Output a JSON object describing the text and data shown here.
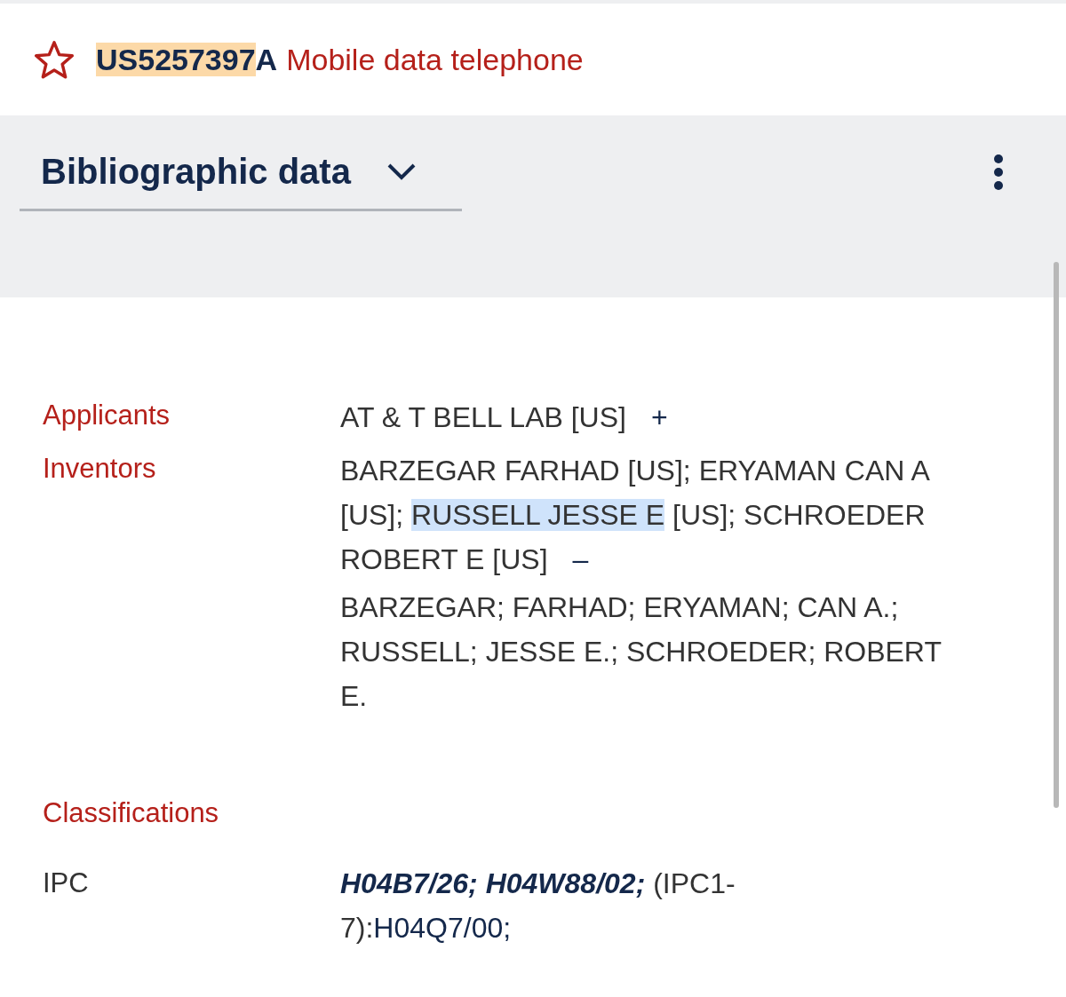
{
  "header": {
    "starred": false,
    "number": [
      {
        "text": "US5257397",
        "highlighted": true
      },
      {
        "text": "A",
        "highlighted": false
      }
    ],
    "title": "Mobile data telephone"
  },
  "section_tab": {
    "label": "Bibliographic data",
    "expanded": false
  },
  "fields": [
    {
      "label": "Applicants",
      "toggle": "+",
      "lines": [
        [
          {
            "text": "AT & T BELL LAB [US]",
            "selected": false
          }
        ]
      ]
    },
    {
      "label": "Inventors",
      "toggle": "–",
      "lines": [
        [
          {
            "text": "BARZEGAR FARHAD [US]; ERYAMAN CAN A [US]; ",
            "selected": false
          },
          {
            "text": "RUSSELL JESSE E",
            "selected": true
          },
          {
            "text": " [US]; SCHROEDER ROBERT E [US]",
            "selected": false
          }
        ],
        [
          {
            "text": "BARZEGAR; FARHAD; ERYAMAN; CAN A.; RUSSELL; JESSE E.; SCHROEDER; ROBERT E.",
            "selected": false
          }
        ]
      ]
    }
  ],
  "classifications": {
    "heading": "Classifications",
    "rows": [
      {
        "label": "IPC",
        "parts": [
          {
            "kind": "code",
            "text": "H04B7/26; H04W88/02;"
          },
          {
            "kind": "plain",
            "text": " (IPC1-7):"
          },
          {
            "kind": "link",
            "text": "H04Q7/00;"
          }
        ]
      }
    ]
  }
}
